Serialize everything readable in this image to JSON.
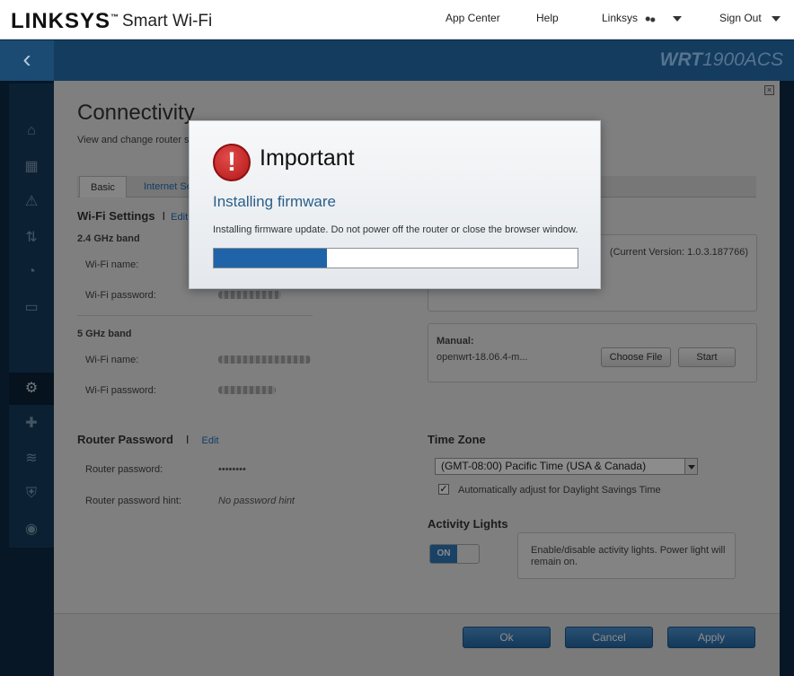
{
  "header": {
    "brand": "LINKSYS",
    "brand_tm": "™",
    "product": "Smart Wi-Fi",
    "nav": {
      "app_center": "App Center",
      "help": "Help",
      "user": "Linksys",
      "sign_out": "Sign Out"
    }
  },
  "subbar": {
    "back": "‹",
    "model_prefix": "WRT",
    "model_suffix": "1900ACS"
  },
  "sidebar": {
    "icons": [
      "router-icon",
      "calendar-icon",
      "warning-icon",
      "update-icon",
      "speed-icon",
      "storage-icon",
      "settings-icon",
      "troubleshoot-icon",
      "wireless-icon",
      "security-icon",
      "openvpn-icon"
    ],
    "active": "settings-icon"
  },
  "page": {
    "title": "Connectivity",
    "subtitle": "View and change router se",
    "close": "×",
    "tabs": [
      {
        "label": "Basic",
        "active": true
      },
      {
        "label": "Internet Se",
        "active": false
      }
    ],
    "wifi": {
      "heading": "Wi-Fi Settings",
      "edit": "Edit",
      "sep": "I",
      "band_24": {
        "heading": "2.4 GHz band",
        "name_label": "Wi-Fi name:",
        "password_label": "Wi-Fi password:"
      },
      "band_5": {
        "heading": "5 GHz band",
        "name_label": "Wi-Fi name:",
        "password_label": "Wi-Fi password:"
      }
    },
    "firmware": {
      "current_version": "(Current Version: 1.0.3.187766)",
      "manual_label": "Manual:",
      "manual_file": "openwrt-18.06.4-m...",
      "choose_file": "Choose File",
      "start": "Start"
    },
    "router_password": {
      "heading": "Router Password",
      "sep": "I",
      "edit": "Edit",
      "password_label": "Router password:",
      "password_value": "••••••••",
      "hint_label": "Router password hint:",
      "hint_value": "No password hint"
    },
    "time_zone": {
      "heading": "Time Zone",
      "selected": "(GMT-08:00) Pacific Time (USA & Canada)",
      "dst_checked": true,
      "dst_check_mark": "✓",
      "dst_label": "Automatically adjust for Daylight Savings Time"
    },
    "activity_lights": {
      "heading": "Activity Lights",
      "state": "ON",
      "info": "Enable/disable activity lights. Power light will remain on."
    },
    "footer": {
      "ok": "Ok",
      "cancel": "Cancel",
      "apply": "Apply"
    }
  },
  "modal": {
    "icon": "!",
    "title": "Important",
    "subtitle": "Installing firmware",
    "message": "Installing firmware update. Do not power off the router or close the browser window.",
    "progress_fraction": 0.31
  },
  "colors": {
    "accent": "#1f64a8",
    "alert": "#c21f1f",
    "header_dark": "#143c5e"
  }
}
